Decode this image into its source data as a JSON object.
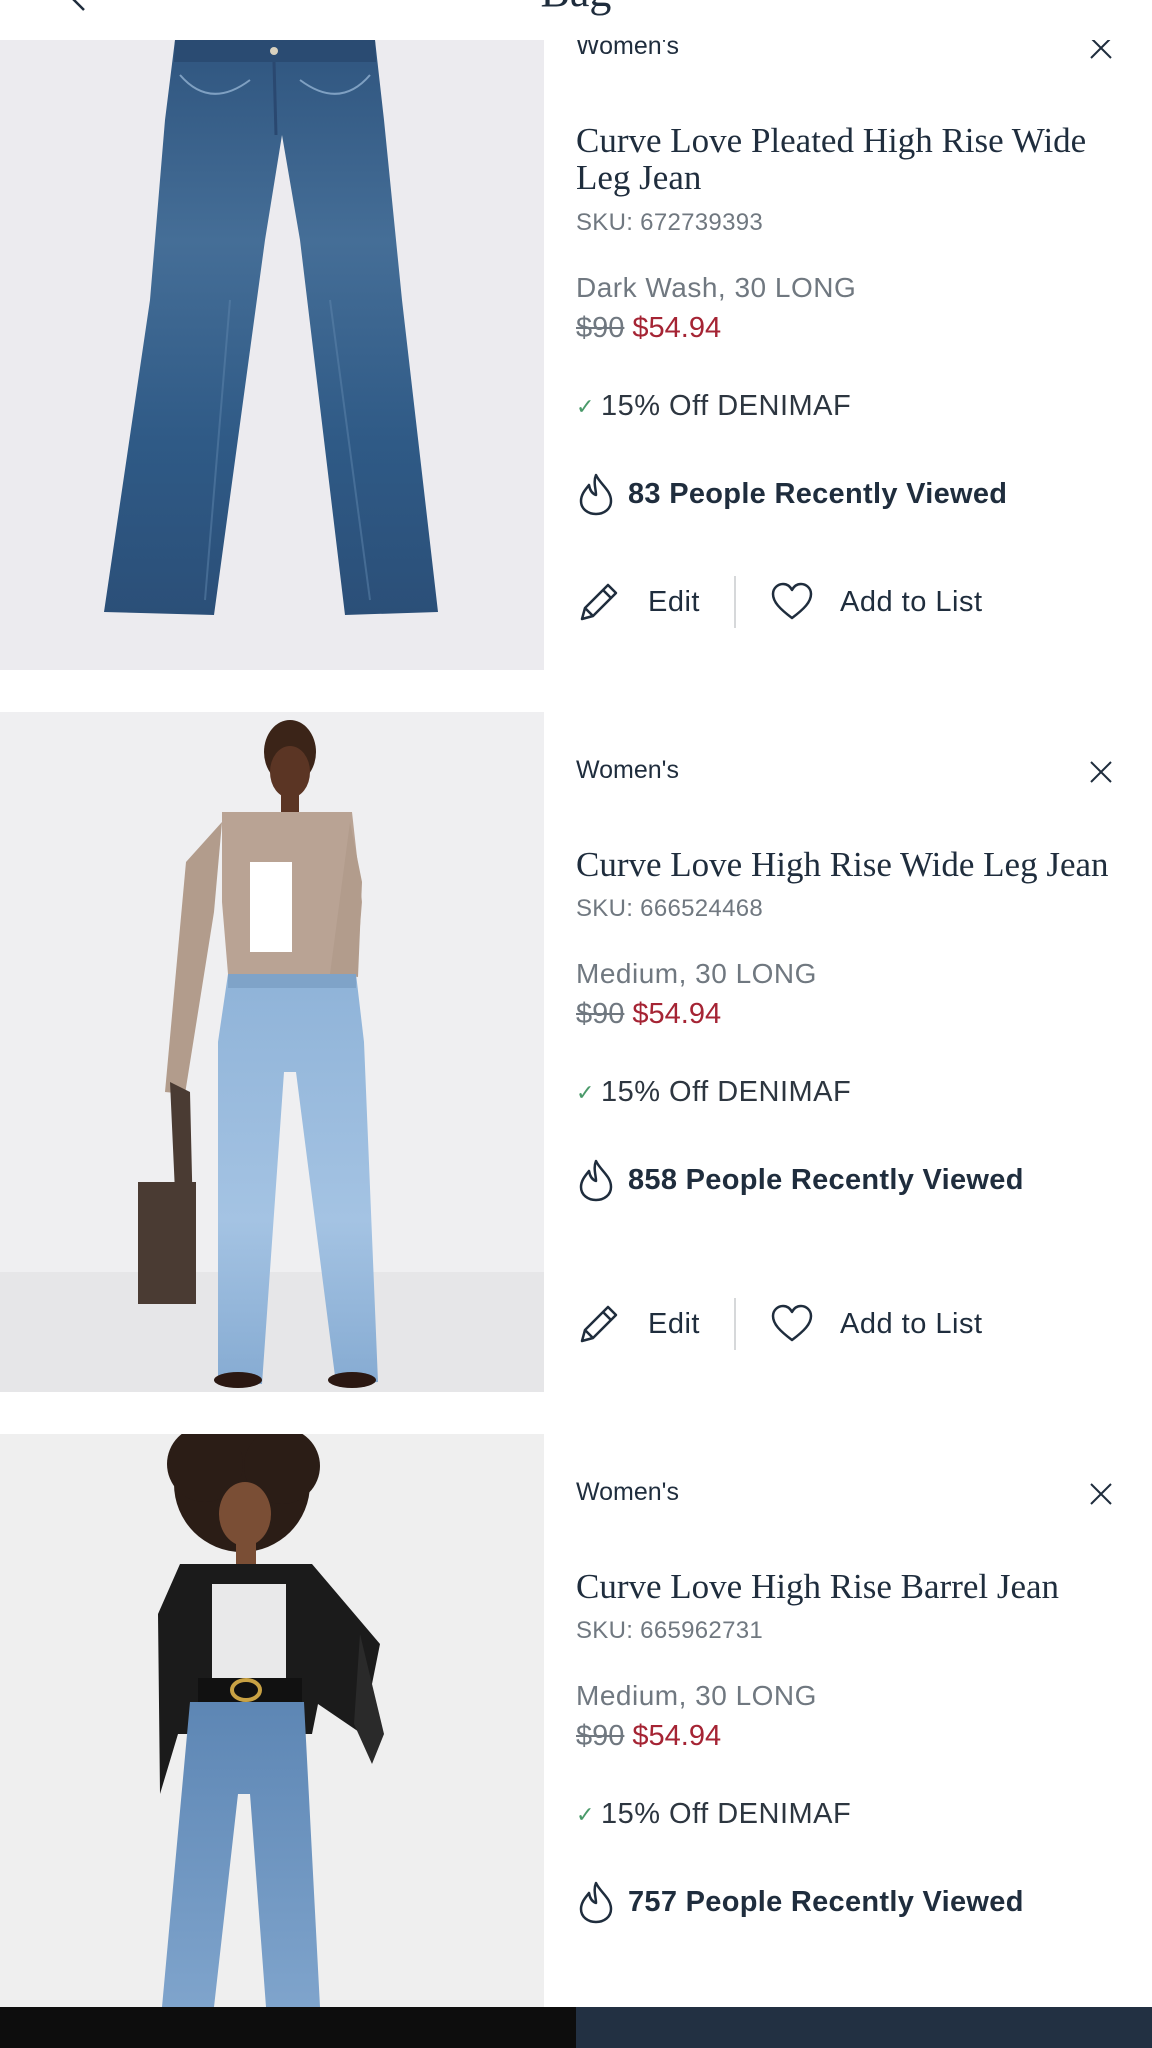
{
  "header": {
    "title": "Bag"
  },
  "items": [
    {
      "category": "Women's",
      "name": "Curve Love Pleated High Rise Wide Leg Jean",
      "sku": "SKU: 672739393",
      "variant": "Dark Wash, 30 LONG",
      "price_original": "$90",
      "price_sale": "$54.94",
      "promo": "15% Off DENIMAF",
      "viewed": "83 People Recently Viewed",
      "edit_label": "Edit",
      "list_label": "Add to List",
      "image": "product-jeans-dark-wash"
    },
    {
      "category": "Women's",
      "name": "Curve Love High Rise Wide Leg Jean",
      "sku": "SKU: 666524468",
      "variant": "Medium, 30 LONG",
      "price_original": "$90",
      "price_sale": "$54.94",
      "promo": "15% Off DENIMAF",
      "viewed": "858 People Recently Viewed",
      "edit_label": "Edit",
      "list_label": "Add to List",
      "image": "model-wide-leg-jean-cardigan"
    },
    {
      "category": "Women's",
      "name": "Curve Love High Rise Barrel Jean",
      "sku": "SKU: 665962731",
      "variant": "Medium, 30 LONG",
      "price_original": "$90",
      "price_sale": "$54.94",
      "promo": "15% Off DENIMAF",
      "viewed": "757 People Recently Viewed",
      "image": "model-barrel-jean-leather-jacket"
    }
  ],
  "colors": {
    "text": "#1f2d3d",
    "muted": "#707880",
    "sale": "#a52434",
    "check": "#4a9a6a",
    "bottom_bar_right": "#223042",
    "bottom_bar_left": "#0d0d0d"
  },
  "icons": [
    "chevron-left-icon",
    "close-icon",
    "checkmark-icon",
    "flame-icon",
    "pencil-icon",
    "heart-icon"
  ]
}
